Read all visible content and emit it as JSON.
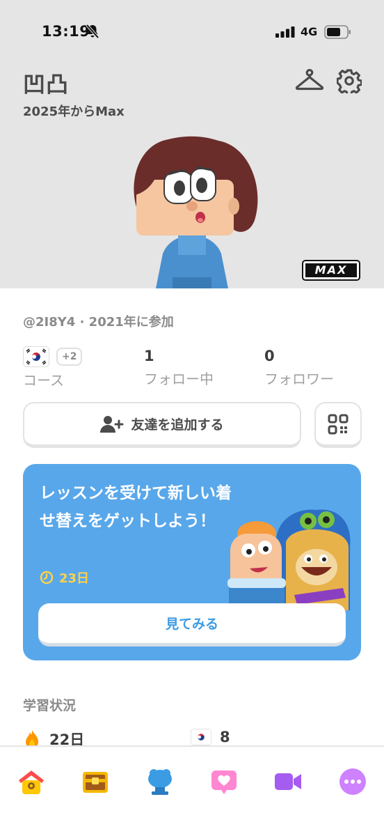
{
  "status_bar": {
    "time": "13:19",
    "network": "4G"
  },
  "profile": {
    "name": "凹凸",
    "member_since": "2025年からMax",
    "handle_joined": "@2I8Y4 · 2021年に参加",
    "badge": "MAX"
  },
  "stats": {
    "course_more": "+2",
    "course_label": "コース",
    "following_value": "1",
    "following_label": "フォロー中",
    "followers_value": "0",
    "followers_label": "フォロワー"
  },
  "actions": {
    "add_friend": "友達を追加する"
  },
  "promo": {
    "title": "レッスンを受けて新しい着せ替えをゲットしよう！",
    "timer": "23日",
    "button": "見てみる"
  },
  "progress_section": {
    "title": "学習状況",
    "streak": "22日",
    "course_count": "8"
  },
  "tabs": [
    {
      "name": "home",
      "icon": "home-icon",
      "color": "#ff4b4b"
    },
    {
      "name": "treasure",
      "icon": "chest-icon",
      "color": "#f5b800"
    },
    {
      "name": "profile",
      "icon": "avatar-icon",
      "color": "#3b9be3"
    },
    {
      "name": "friends",
      "icon": "heart-icon",
      "color": "#ff86d0"
    },
    {
      "name": "video",
      "icon": "video-icon",
      "color": "#a55cf0"
    },
    {
      "name": "more",
      "icon": "more-icon",
      "color": "#ce82ff"
    }
  ]
}
